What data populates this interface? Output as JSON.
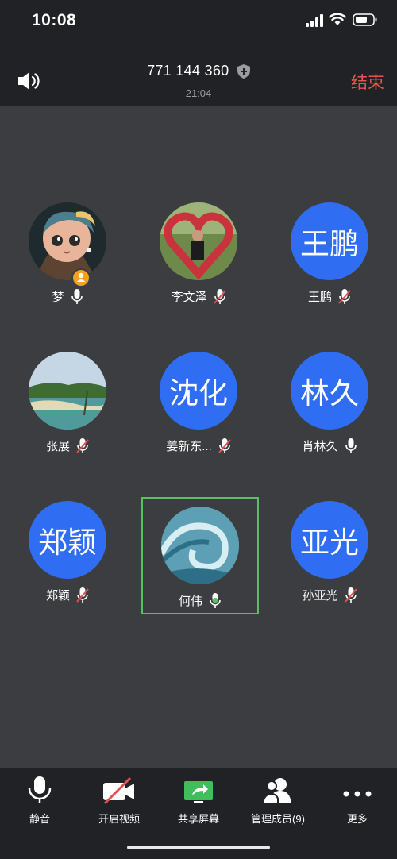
{
  "status_bar": {
    "time": "10:08"
  },
  "header": {
    "meeting_id": "771 144 360",
    "duration": "21:04",
    "end_label": "结束"
  },
  "participants": [
    {
      "name": "梦",
      "avatar": "photo-girl",
      "mic": "on",
      "host": true
    },
    {
      "name": "李文泽",
      "avatar": "photo-heart",
      "mic": "muted"
    },
    {
      "name": "王鹏",
      "avatar_text": "王鹏",
      "mic": "muted"
    },
    {
      "name": "张展",
      "avatar": "photo-beach",
      "mic": "muted"
    },
    {
      "name": "姜新东...",
      "avatar_text": "沈化",
      "mic": "muted"
    },
    {
      "name": "肖林久",
      "avatar_text": "林久",
      "mic": "on"
    },
    {
      "name": "郑颖",
      "avatar_text": "郑颖",
      "mic": "muted"
    },
    {
      "name": "何伟",
      "avatar": "photo-wave",
      "mic": "speaking",
      "active": true
    },
    {
      "name": "孙亚光",
      "avatar_text": "亚光",
      "mic": "muted"
    }
  ],
  "toolbar": {
    "mute": "静音",
    "video": "开启视频",
    "share": "共享屏幕",
    "members": "管理成员(9)",
    "more": "更多"
  },
  "colors": {
    "accent_blue": "#2f6ef3",
    "end_red": "#e2594b",
    "active_green": "#5bbf63",
    "muted_red": "#e25050"
  }
}
